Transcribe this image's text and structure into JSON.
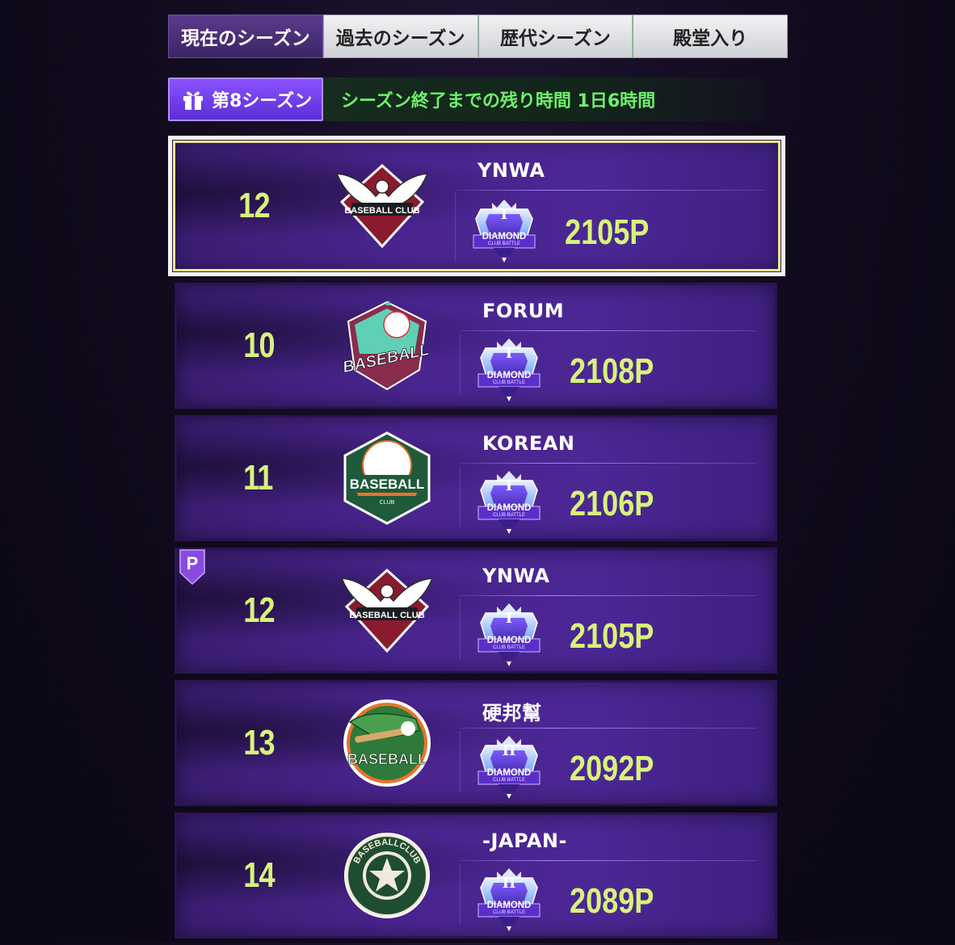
{
  "tabs": [
    {
      "label": "現在のシーズン",
      "active": true
    },
    {
      "label": "過去のシーズン",
      "active": false
    },
    {
      "label": "歴代シーズン",
      "active": false
    },
    {
      "label": "殿堂入り",
      "active": false
    }
  ],
  "season": {
    "badge_label": "第8シーズン",
    "remaining_text": "シーズン終了までの残り時間 1日6時間"
  },
  "colors": {
    "rank_text": "#d8f27a",
    "points_text": "#d8f27a",
    "timer_text": "#6ef06a",
    "highlight_border": "#f4f4f0"
  },
  "rows": [
    {
      "rank": "12",
      "team": "YNWA",
      "points": "2105P",
      "tier": "DIAMOND",
      "tier_level": "I",
      "tier_sub": "CLUB BATTLE",
      "logo": "eagle-baseball-club-logo",
      "logo_text": "BASEBALL CLUB",
      "highlighted": true,
      "p_badge": false
    },
    {
      "rank": "10",
      "team": "FORUM",
      "points": "2108P",
      "tier": "DIAMOND",
      "tier_level": "I",
      "tier_sub": "CLUB BATTLE",
      "logo": "baseball-shield-logo",
      "logo_text": "BASEBALL",
      "highlighted": false,
      "p_badge": false
    },
    {
      "rank": "11",
      "team": "KOREAN",
      "points": "2106P",
      "tier": "DIAMOND",
      "tier_level": "I",
      "tier_sub": "CLUB BATTLE",
      "logo": "baseball-club-ball-logo",
      "logo_text": "BASEBALL",
      "logo_subtext": "CLUB",
      "highlighted": false,
      "p_badge": false
    },
    {
      "rank": "12",
      "team": "YNWA",
      "points": "2105P",
      "tier": "DIAMOND",
      "tier_level": "I",
      "tier_sub": "CLUB BATTLE",
      "logo": "eagle-baseball-club-logo",
      "logo_text": "BASEBALL CLUB",
      "highlighted": false,
      "p_badge": true,
      "p_badge_label": "P"
    },
    {
      "rank": "13",
      "team": "硬邦幫",
      "points": "2092P",
      "tier": "DIAMOND",
      "tier_level": "II",
      "tier_sub": "CLUB BATTLE",
      "logo": "crocodile-baseball-logo",
      "logo_text": "BASEBALL",
      "highlighted": false,
      "p_badge": false
    },
    {
      "rank": "14",
      "team": "-JAPAN-",
      "points": "2089P",
      "tier": "DIAMOND",
      "tier_level": "II",
      "tier_sub": "CLUB BATTLE",
      "logo": "star-baseball-club-logo",
      "logo_text": "BASEBALLCLUB",
      "highlighted": false,
      "p_badge": false
    }
  ]
}
